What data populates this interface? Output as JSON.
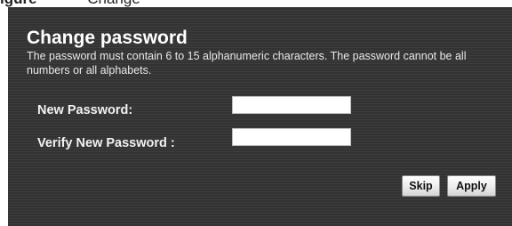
{
  "figure_caption": {
    "label": "igure",
    "text": "Change"
  },
  "form": {
    "title": "Change password",
    "description": "The password must contain 6 to 15 alphanumeric characters. The password cannot be all numbers or all alphabets.",
    "fields": {
      "new_password": {
        "label": "New Password:",
        "value": ""
      },
      "verify_new_password": {
        "label": "Verify New Password :",
        "value": ""
      }
    },
    "buttons": {
      "skip": "Skip",
      "apply": "Apply"
    }
  },
  "colors": {
    "panel_background": "#363636",
    "text": "#ffffff",
    "input_background": "#ffffff"
  }
}
